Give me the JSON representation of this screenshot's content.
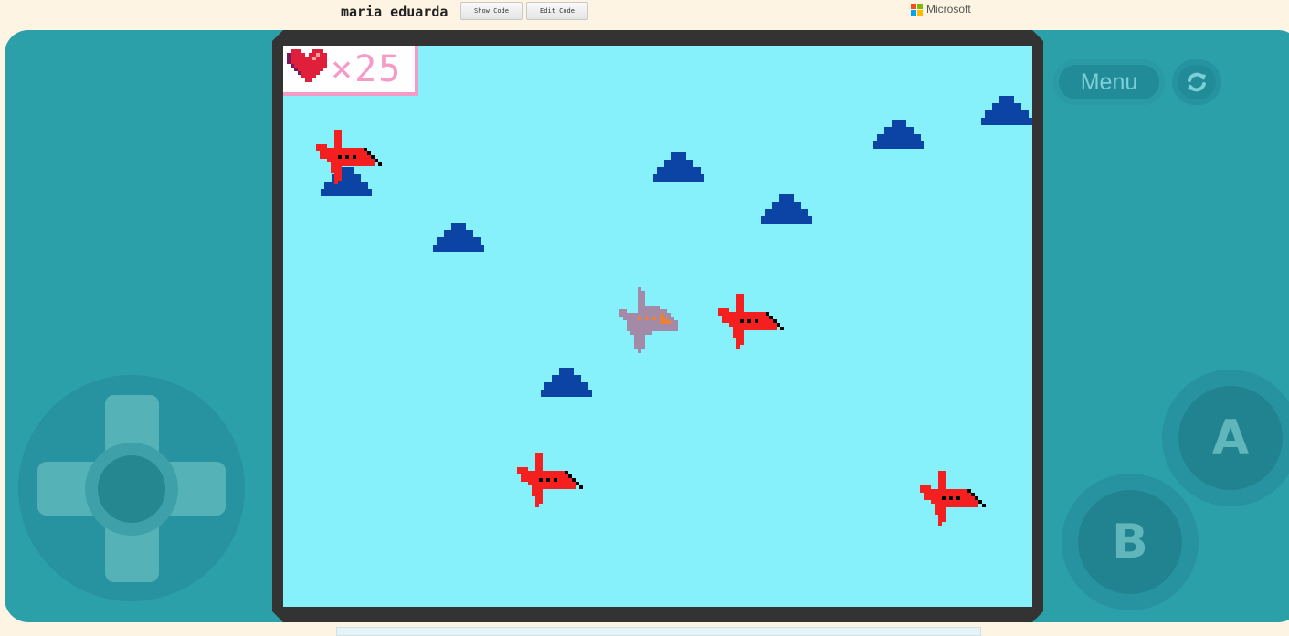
{
  "header": {
    "project_title": "maria eduarda",
    "show_code_label": "Show Code",
    "edit_code_label": "Edit Code",
    "brand": "Microsoft"
  },
  "game": {
    "lives_count": "×25",
    "colors": {
      "sky": "#86f0fb",
      "cloud": "#0b44a4",
      "enemy_plane": "#f42020",
      "player_plane": "#a38ba8",
      "hud_accent": "#f59bc8"
    }
  },
  "controls": {
    "menu_label": "Menu",
    "reload_icon": "reload-icon",
    "a_label": "A",
    "b_label": "B"
  }
}
